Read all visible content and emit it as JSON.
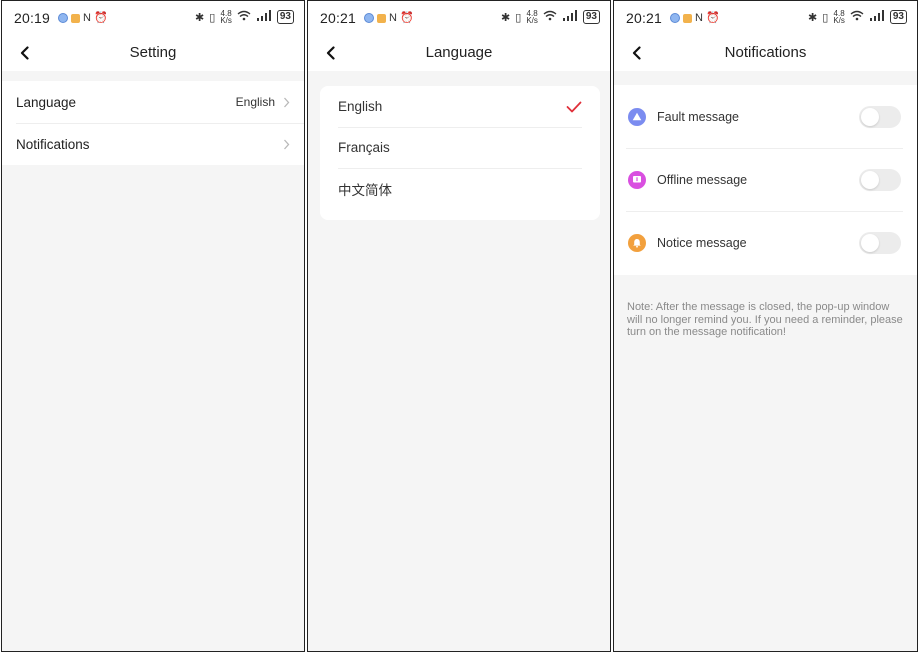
{
  "panels": [
    {
      "status_time": "20:19",
      "title": "Setting",
      "rows": [
        {
          "label": "Language",
          "value": "English"
        },
        {
          "label": "Notifications",
          "value": ""
        }
      ]
    },
    {
      "status_time": "20:21",
      "title": "Language",
      "options": [
        {
          "label": "English",
          "selected": true
        },
        {
          "label": "Français",
          "selected": false
        },
        {
          "label": "中文简体",
          "selected": false
        }
      ]
    },
    {
      "status_time": "20:21",
      "title": "Notifications",
      "items": [
        {
          "label": "Fault message",
          "icon": "warning-icon",
          "color": "#7b8cf0",
          "enabled": false
        },
        {
          "label": "Offline message",
          "icon": "offline-icon",
          "color": "#d94fe0",
          "enabled": false
        },
        {
          "label": "Notice message",
          "icon": "bell-icon",
          "color": "#f2a03d",
          "enabled": false
        }
      ],
      "note": "Note: After the message is closed, the pop-up window will no longer remind you. If you need a reminder, please turn on the message notification!"
    }
  ],
  "status": {
    "battery": "93",
    "speed_top": "4.8",
    "speed_bottom": "K/s"
  },
  "colors": {
    "accent_check": "#e0303a",
    "toggle_off": "#ececec"
  }
}
